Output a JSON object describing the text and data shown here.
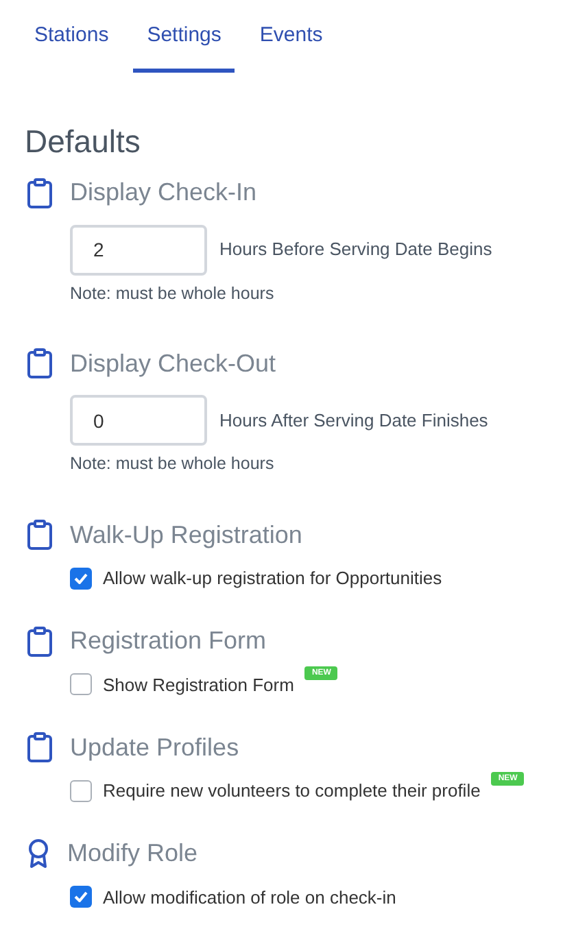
{
  "tabs": [
    {
      "label": "Stations",
      "selected": false
    },
    {
      "label": "Settings",
      "selected": true
    },
    {
      "label": "Events",
      "selected": false
    }
  ],
  "heading": "Defaults",
  "sections": [
    {
      "kind": "number",
      "title": "Display Check-In",
      "value": "2",
      "suffix": "Hours Before Serving Date Begins",
      "note": "Note: must be whole hours"
    },
    {
      "kind": "number",
      "title": "Display Check-Out",
      "value": "0",
      "suffix": "Hours After Serving Date Finishes",
      "note": "Note: must be whole hours"
    },
    {
      "kind": "checkbox",
      "title": "Walk-Up Registration",
      "label": "Allow walk-up registration for Opportunities",
      "checked": true
    },
    {
      "kind": "checkbox",
      "title": "Registration Form",
      "label": "Show Registration Form",
      "checked": false,
      "badge": "NEW"
    },
    {
      "kind": "checkbox",
      "title": "Update Profiles",
      "label": "Require new volunteers to complete their profile",
      "checked": false,
      "badge": "NEW"
    },
    {
      "kind": "checkbox",
      "title": "Modify Role",
      "label": "Allow modification of role on check-in",
      "checked": true
    }
  ]
}
